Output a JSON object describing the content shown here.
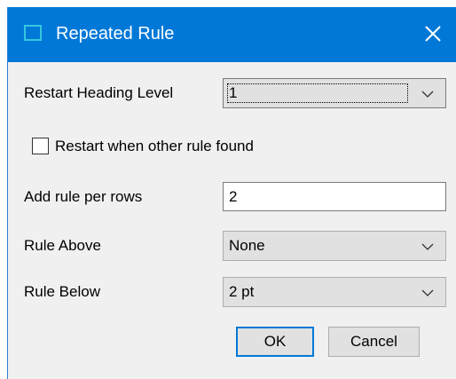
{
  "window": {
    "title": "Repeated Rule",
    "icon": "window-icon",
    "close_icon": "close-icon",
    "accent_color": "#0078d7"
  },
  "form": {
    "restart_heading_level": {
      "label": "Restart Heading Level",
      "value": "1"
    },
    "restart_when_other_rule_found": {
      "label": "Restart when other rule found",
      "checked": false
    },
    "add_rule_per_rows": {
      "label": "Add rule per rows",
      "value": "2"
    },
    "rule_above": {
      "label": "Rule Above",
      "value": "None"
    },
    "rule_below": {
      "label": "Rule Below",
      "value": "2 pt"
    }
  },
  "buttons": {
    "ok": "OK",
    "cancel": "Cancel"
  }
}
